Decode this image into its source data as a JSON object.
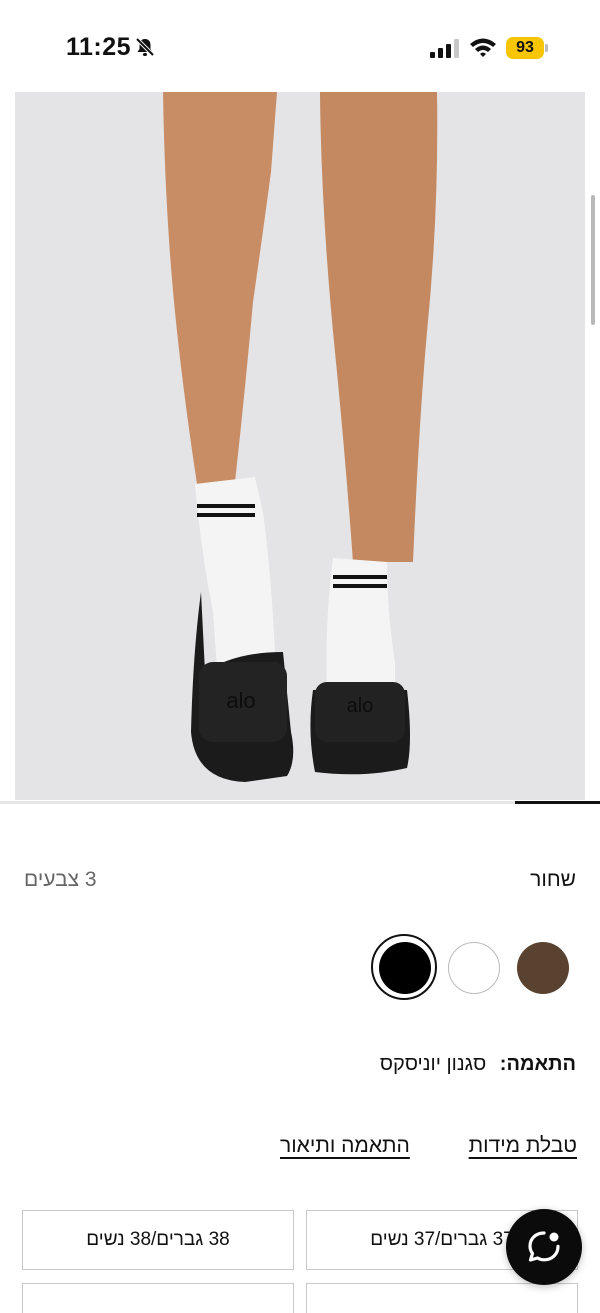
{
  "status_bar": {
    "time": "11:25",
    "battery": "93"
  },
  "product": {
    "image_alt": "black alo slides worn with white socks",
    "color": {
      "selected_name": "שחור",
      "count_label": "3 צבעים",
      "swatches": [
        {
          "name": "black",
          "hex": "#000000",
          "selected": true
        },
        {
          "name": "white",
          "hex": "#ffffff",
          "selected": false
        },
        {
          "name": "brown",
          "hex": "#5a4231",
          "selected": false
        }
      ]
    },
    "fit": {
      "label": "התאמה:",
      "value": "סגנון יוניסקס"
    },
    "links": {
      "size_chart": "טבלת מידות",
      "fit_description": "התאמה ותיאור"
    },
    "sizes": [
      "37 גברים/37 נשים",
      "38 גברים/38 נשים",
      "",
      ""
    ]
  },
  "icons": {
    "bell": "bell-slash-icon",
    "signal": "signal-icon",
    "wifi": "wifi-icon",
    "chat": "chat-icon"
  }
}
